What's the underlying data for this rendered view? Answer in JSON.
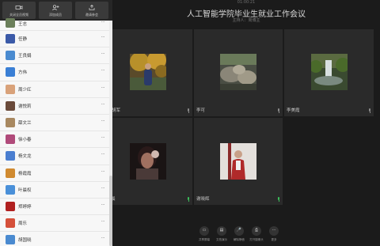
{
  "header": {
    "timer": "01:00:21",
    "title": "人工智能学院毕业生就业工作会议",
    "host": "主持人：周博主"
  },
  "sidebar": {
    "actions": [
      {
        "label": "关闭全员视频",
        "icon": "video-icon"
      },
      {
        "label": "添加成员",
        "icon": "add-user-icon"
      },
      {
        "label": "邀请参会",
        "icon": "invite-icon"
      }
    ],
    "members": [
      {
        "name": "王志",
        "avatar_color": "#6b7f5a"
      },
      {
        "name": "任静",
        "avatar_color": "#3b5aa8"
      },
      {
        "name": "王良娟",
        "avatar_color": "#4a8bd0"
      },
      {
        "name": "方伟",
        "avatar_color": "#3a7fd5"
      },
      {
        "name": "周少红",
        "avatar_color": "#d9a27a"
      },
      {
        "name": "谢悦莉",
        "avatar_color": "#6a4a3a"
      },
      {
        "name": "薛文兰",
        "avatar_color": "#a88860"
      },
      {
        "name": "徐小春",
        "avatar_color": "#b04a7a"
      },
      {
        "name": "杨文龙",
        "avatar_color": "#4a7ed0"
      },
      {
        "name": "杨霞霞",
        "avatar_color": "#d08a30"
      },
      {
        "name": "叶晨权",
        "avatar_color": "#4a90d9"
      },
      {
        "name": "郑婷婷",
        "avatar_color": "#b02020"
      },
      {
        "name": "周乐",
        "avatar_color": "#d5503a"
      },
      {
        "name": "胡国晓",
        "avatar_color": "#4a8ad0"
      }
    ],
    "more_label": "···"
  },
  "tiles": [
    {
      "name": "胡军",
      "photo": "autumn-tree",
      "mic": "gray"
    },
    {
      "name": "李可",
      "photo": "rock-garden",
      "mic": "gray"
    },
    {
      "name": "李美霞",
      "photo": "waterfall",
      "mic": "gray"
    },
    {
      "name": "晨",
      "photo": "portrait-dark",
      "mic": "green"
    },
    {
      "name": "谢晓辉",
      "photo": "portrait-red",
      "mic": "green"
    }
  ],
  "toolbar": [
    {
      "label": "共享屏幕",
      "glyph": "▭",
      "icon": "screen-share-icon"
    },
    {
      "label": "文档演示",
      "glyph": "▤",
      "icon": "document-icon"
    },
    {
      "label": "解除静音",
      "glyph": "🎤",
      "icon": "mute-icon"
    },
    {
      "label": "打开摄像头",
      "glyph": "⎙",
      "icon": "camera-icon"
    },
    {
      "label": "更多",
      "glyph": "···",
      "icon": "more-icon"
    }
  ],
  "colors": {
    "background": "#1b1b1b",
    "tile": "#2a2a2a",
    "sidebar": "#f7f7f7",
    "mic_active": "#3bbd5a"
  }
}
